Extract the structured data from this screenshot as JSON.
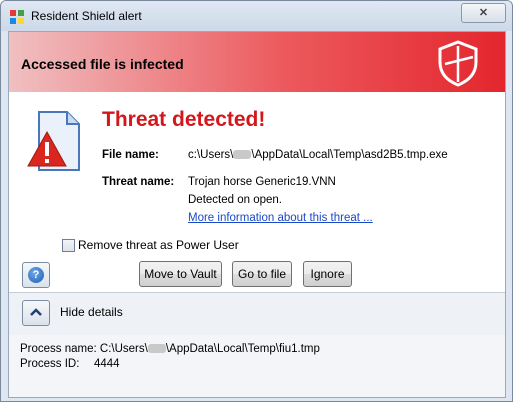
{
  "window": {
    "title": "Resident Shield alert",
    "close_glyph": "✕"
  },
  "banner": {
    "heading": "Accessed file is infected",
    "icon": "shield-icon",
    "gradient_colors": [
      "#f0c0c2",
      "#e3262d"
    ]
  },
  "alert": {
    "title": "Threat detected!",
    "title_color": "#d2181d",
    "icon": "warning-document-icon",
    "file_label": "File name:",
    "file_prefix": "c:\\Users\\",
    "file_suffix": "\\AppData\\Local\\Temp\\asd2B5.tmp.exe",
    "threat_label": "Threat name:",
    "threat_name": "Trojan horse Generic19.VNN",
    "detected_text": "Detected on open.",
    "more_info_link": "More information about this threat ..."
  },
  "options": {
    "remove_power_user_label": "Remove threat as Power User",
    "remove_power_user_checked": false
  },
  "buttons": {
    "help_glyph": "?",
    "move_to_vault": "Move to Vault",
    "go_to_file": "Go to file",
    "ignore": "Ignore"
  },
  "details": {
    "toggle_label": "Hide details",
    "process_name_label": "Process name:",
    "process_name_prefix": "C:\\Users\\",
    "process_name_suffix": "\\AppData\\Local\\Temp\\fiu1.tmp",
    "process_id_label": "Process ID:",
    "process_id": "4444"
  }
}
